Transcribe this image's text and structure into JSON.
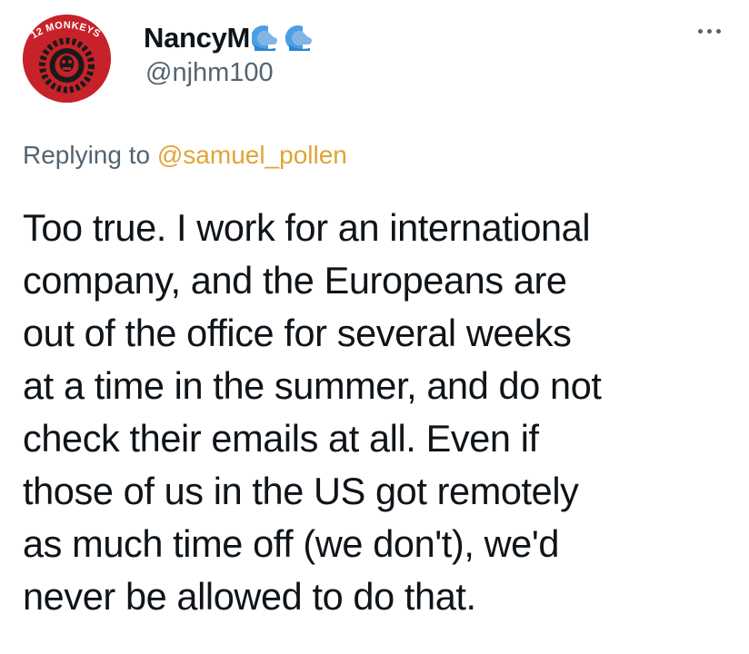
{
  "author": {
    "display_name": "NancyM",
    "handle": "@njhm100",
    "avatar_text": "12 MONKEYS",
    "name_emoji": "water-wave-emoji"
  },
  "reply": {
    "prefix": "Replying to",
    "mention": "@samuel_pollen"
  },
  "tweet": {
    "lines": [
      "Too true. I work for an international",
      "company, and the Europeans are",
      "out of the office for several weeks",
      "at a time in the summer, and do not",
      "check their emails at all. Even if",
      "those of us in the US got remotely",
      "as much time off (we don't), we'd",
      "never be allowed to do that."
    ]
  },
  "icons": {
    "more": "more-horizontal-icon"
  },
  "colors": {
    "mention": "#e1a435",
    "secondary_text": "#536471",
    "primary_text": "#0f1419",
    "avatar_bg": "#c7222a"
  }
}
